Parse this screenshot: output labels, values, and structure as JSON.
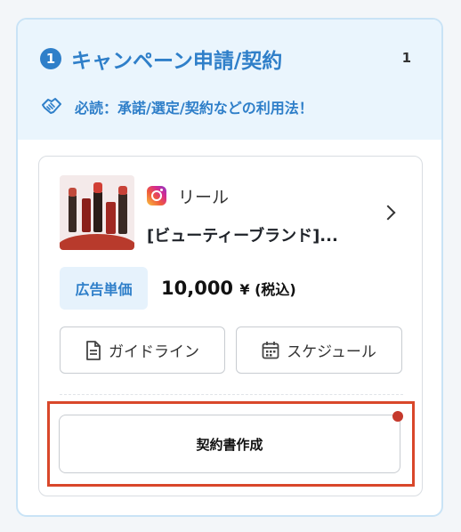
{
  "header": {
    "step_number": "1",
    "title": "キャンペーン申請/契約",
    "count": "1",
    "link_text": "必読：承諾/選定/契約などの利用法！"
  },
  "campaign": {
    "platform": "リール",
    "product_name": "[ビューティーブランド]...",
    "price_label": "広告単価",
    "price_value": "10,000",
    "price_unit": "¥ (税込)"
  },
  "actions": {
    "guideline_label": "ガイドライン",
    "schedule_label": "スケジュール",
    "contract_label": "契約書作成"
  },
  "colors": {
    "accent": "#2f7fc9",
    "header_bg": "#eaf5fd",
    "highlight": "#d9472a",
    "notify_dot": "#c5392c"
  },
  "icons": {
    "step": "numbered-circle-icon",
    "guide_link": "handshake-icon",
    "platform": "instagram-icon",
    "chevron": "chevron-right-icon",
    "guideline": "document-icon",
    "schedule": "calendar-icon"
  }
}
